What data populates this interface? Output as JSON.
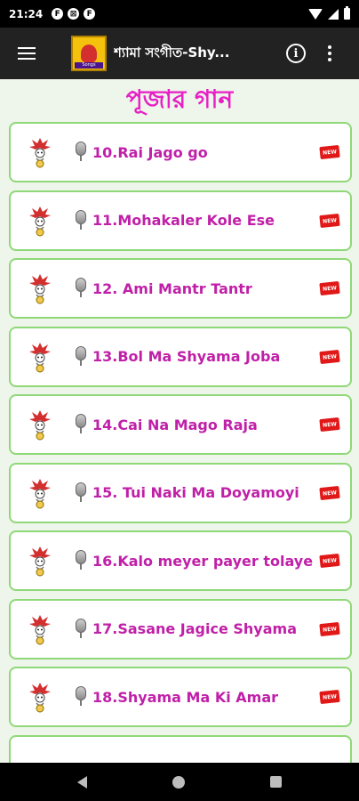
{
  "status_bar": {
    "time": "21:24",
    "notif_icons": [
      "F",
      "⊠",
      "F"
    ],
    "right_icons": [
      "wifi-icon",
      "signal-icon",
      "battery-icon"
    ]
  },
  "app_bar": {
    "title": "শ্যামা সংগীত-Shy...",
    "logo_tag": "Songs",
    "info_icon": "info-icon",
    "more_icon": "more-vert-icon",
    "menu_icon": "hamburger-menu-icon"
  },
  "content": {
    "heading": "পূজার গান",
    "songs": [
      {
        "title": "10.Rai Jago go",
        "badge": "NEW"
      },
      {
        "title": "11.Mohakaler Kole Ese",
        "badge": "NEW"
      },
      {
        "title": "12. Ami Mantr Tantr",
        "badge": "NEW"
      },
      {
        "title": "13.Bol Ma Shyama Joba",
        "badge": "NEW"
      },
      {
        "title": "14.Cai Na Mago Raja",
        "badge": "NEW"
      },
      {
        "title": "15. Tui Naki Ma Doyamoyi",
        "badge": "NEW"
      },
      {
        "title": "16.Kalo meyer payer tolaye",
        "badge": "NEW"
      },
      {
        "title": "17.Sasane Jagice Shyama",
        "badge": "NEW"
      },
      {
        "title": "18.Shyama Ma Ki Amar",
        "badge": "NEW"
      }
    ]
  },
  "colors": {
    "accent_heading": "#e81fc7",
    "song_text": "#c020a8",
    "card_border": "#8fd877",
    "background": "#eef5ea",
    "app_bar": "#222222"
  }
}
